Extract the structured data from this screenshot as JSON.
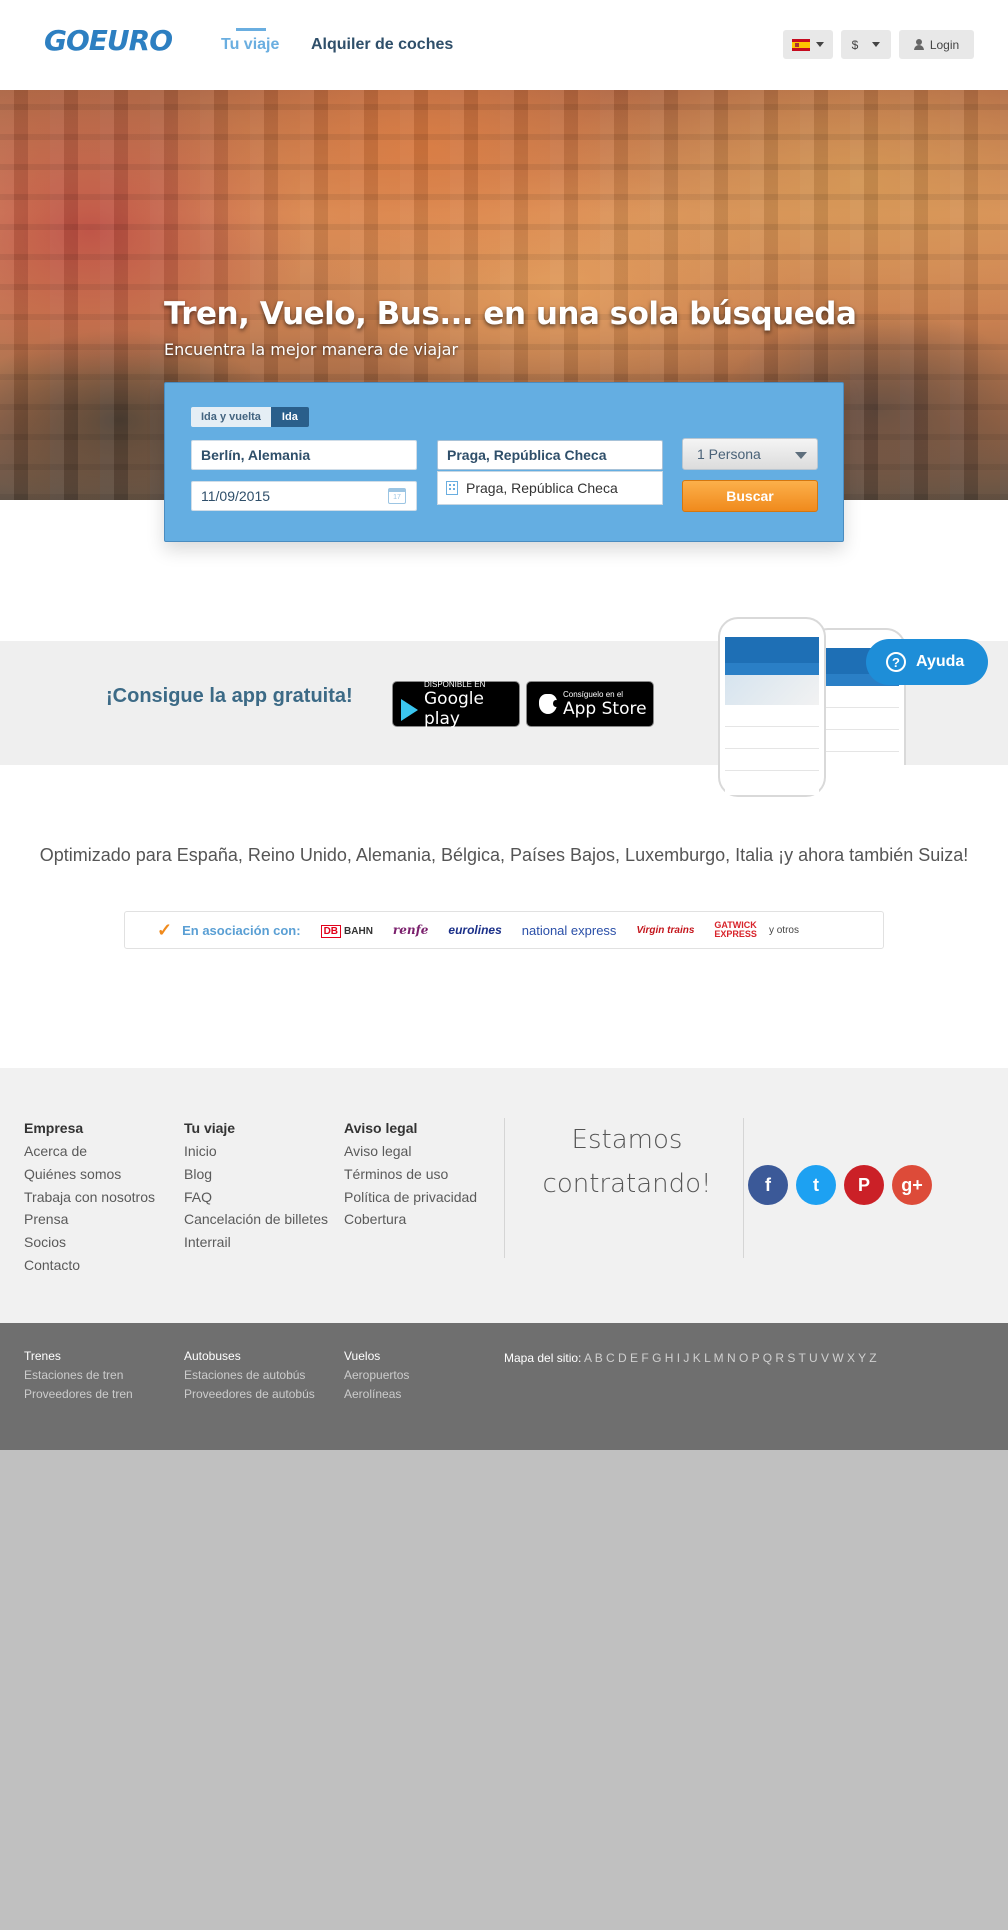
{
  "header": {
    "logo": "GOEURO",
    "tabs": [
      {
        "label": "Tu viaje",
        "active": true
      },
      {
        "label": "Alquiler de coches",
        "active": false
      }
    ],
    "language_icon": "spain-flag-icon",
    "currency": "$",
    "login_label": "Login"
  },
  "hero": {
    "title": "Tren, Vuelo, Bus... en una sola búsqueda",
    "subtitle": "Encuentra la mejor manera de viajar"
  },
  "search": {
    "trip_types": [
      "Ida y vuelta",
      "Ida"
    ],
    "selected_trip_type": "Ida",
    "origin": "Berlín, Alemania",
    "destination": "Praga, República Checa",
    "date": "11/09/2015",
    "suggestion": "Praga, República Checa",
    "passengers": "1 Persona",
    "search_label": "Buscar",
    "calendar_day": "17"
  },
  "app_banner": {
    "title": "¡Consigue la app gratuita!",
    "google_play_small": "DISPONIBLE EN",
    "google_play_big": "Google play",
    "app_store_small": "Consíguelo en el",
    "app_store_big": "App Store"
  },
  "help": {
    "label": "Ayuda"
  },
  "optimized": {
    "text": "Optimizado para España, Reino Unido, Alemania, Bélgica, Países Bajos, Luxemburgo, Italia ¡y ahora también Suiza!",
    "partners_label": "En asociación con:",
    "partners": [
      "DB",
      "BAHN",
      "renfe",
      "eurolines",
      "national express",
      "Virgin trains",
      "GATWICK",
      "EXPRESS"
    ],
    "others": "y otros"
  },
  "footer": {
    "columns": [
      {
        "title": "Empresa",
        "links": [
          "Acerca de",
          "Quiénes somos",
          "Trabaja con nosotros",
          "Prensa",
          "Socios",
          "Contacto"
        ]
      },
      {
        "title": "Tu viaje",
        "links": [
          "Inicio",
          "Blog",
          "FAQ",
          "Cancelación de billetes",
          "Interrail"
        ]
      },
      {
        "title": "Aviso legal",
        "links": [
          "Aviso legal",
          "Términos de uso",
          "Política de privacidad",
          "Cobertura"
        ]
      }
    ],
    "hiring_line1": "Estamos",
    "hiring_line2": "contratando!",
    "social": [
      "facebook-icon",
      "twitter-icon",
      "pinterest-icon",
      "google-plus-icon"
    ]
  },
  "subfooter": {
    "columns": [
      {
        "title": "Trenes",
        "links": [
          "Estaciones de tren",
          "Proveedores de tren"
        ]
      },
      {
        "title": "Autobuses",
        "links": [
          "Estaciones de autobús",
          "Proveedores de autobús"
        ]
      },
      {
        "title": "Vuelos",
        "links": [
          "Aeropuertos",
          "Aerolíneas"
        ]
      }
    ],
    "sitemap_label": "Mapa del sitio:",
    "sitemap_letters": "A B C D E F G H I J K L M N O P Q R S T U V W X Y Z"
  }
}
